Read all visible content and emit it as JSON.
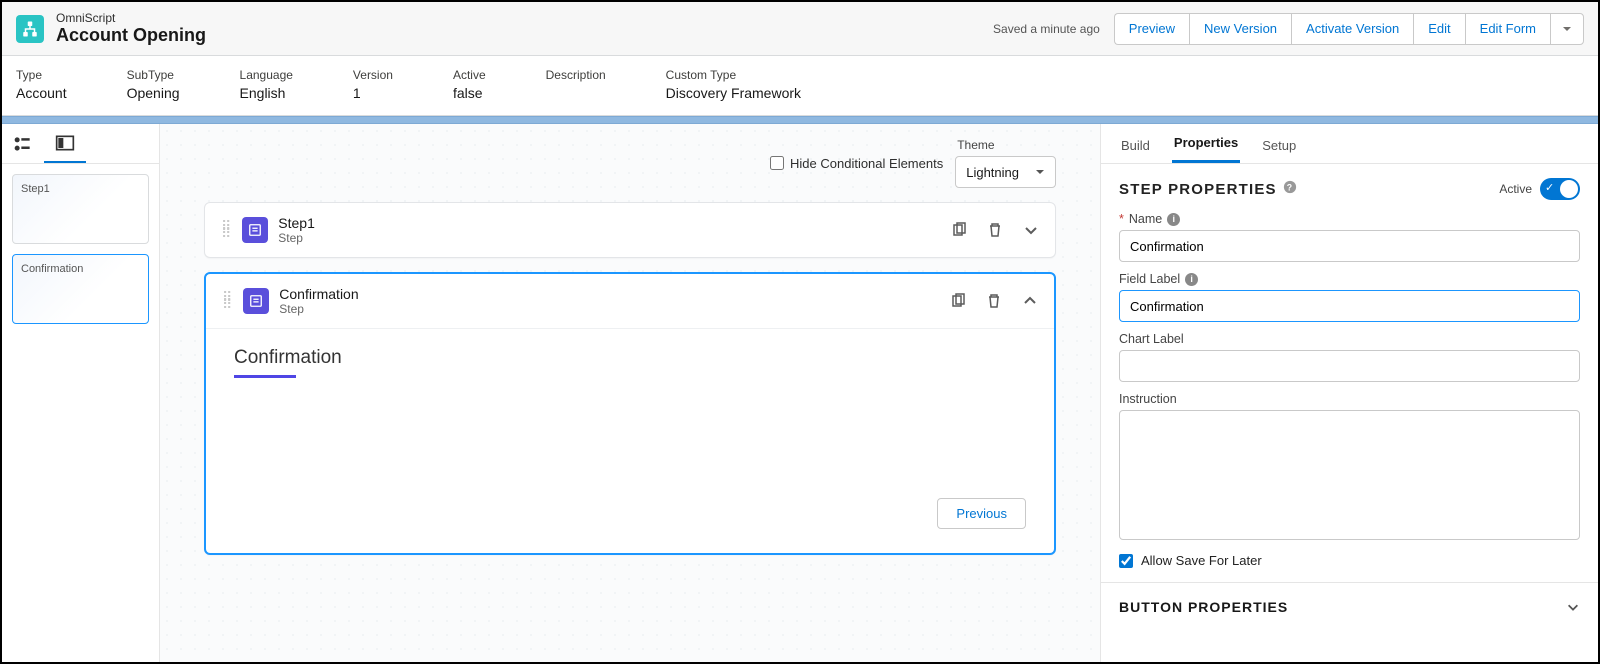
{
  "header": {
    "subtitle": "OmniScript",
    "title": "Account Opening",
    "saved": "Saved a minute ago",
    "buttons": [
      "Preview",
      "New Version",
      "Activate Version",
      "Edit",
      "Edit Form"
    ]
  },
  "meta": [
    {
      "label": "Type",
      "value": "Account"
    },
    {
      "label": "SubType",
      "value": "Opening"
    },
    {
      "label": "Language",
      "value": "English"
    },
    {
      "label": "Version",
      "value": "1"
    },
    {
      "label": "Active",
      "value": "false"
    },
    {
      "label": "Description",
      "value": ""
    },
    {
      "label": "Custom Type",
      "value": "Discovery Framework"
    }
  ],
  "sidebar": {
    "thumbs": [
      "Step1",
      "Confirmation"
    ]
  },
  "canvas": {
    "hideConditional": "Hide Conditional Elements",
    "themeLabel": "Theme",
    "themeValue": "Lightning",
    "steps": [
      {
        "name": "Step1",
        "sub": "Step"
      },
      {
        "name": "Confirmation",
        "sub": "Step"
      }
    ],
    "selectedTitle": "Confirmation",
    "prev": "Previous"
  },
  "right": {
    "tabs": [
      "Build",
      "Properties",
      "Setup"
    ],
    "sectionTitle": "STEP PROPERTIES",
    "activeLabel": "Active",
    "fields": {
      "nameLabel": "Name",
      "nameValue": "Confirmation",
      "fieldLabel": "Field Label",
      "fieldValue": "Confirmation",
      "chartLabel": "Chart Label",
      "chartValue": "",
      "instructionLabel": "Instruction",
      "allowSave": "Allow Save For Later"
    },
    "accordion": "BUTTON PROPERTIES"
  }
}
